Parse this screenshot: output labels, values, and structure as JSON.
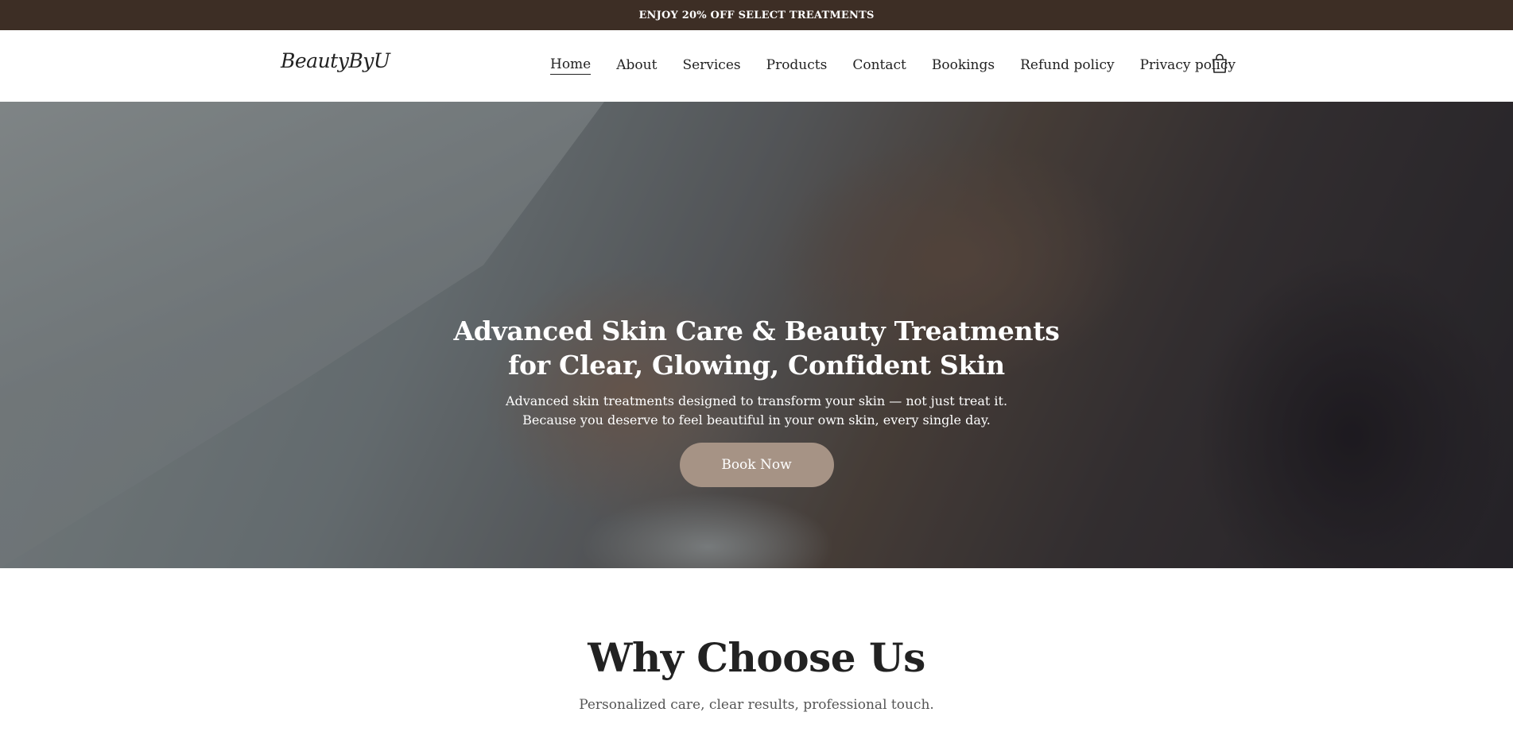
{
  "announcement": {
    "text": "ENJOY 20% OFF SELECT TREATMENTS"
  },
  "header": {
    "logo": "BeautyByU",
    "nav": [
      {
        "label": "Home",
        "active": true
      },
      {
        "label": "About"
      },
      {
        "label": "Services"
      },
      {
        "label": "Products"
      },
      {
        "label": "Contact"
      },
      {
        "label": "Bookings"
      },
      {
        "label": "Refund policy"
      },
      {
        "label": "Privacy policy"
      }
    ],
    "cart_icon": "shopping-bag-icon"
  },
  "hero": {
    "title_line1": "Advanced Skin Care & Beauty Treatments",
    "title_line2": "for Clear, Glowing, Confident Skin",
    "subtitle_line1": "Advanced skin treatments designed to transform your skin — not just treat it.",
    "subtitle_line2": "Because you deserve to feel beautiful in your own skin, every single day.",
    "button_label": "Book Now"
  },
  "why": {
    "title": "Why Choose Us",
    "subtitle": "Personalized care, clear results, professional touch."
  },
  "colors": {
    "announcement_bg": "#3d2e25",
    "button_bg": "#a69385",
    "text_dark": "#222222"
  }
}
